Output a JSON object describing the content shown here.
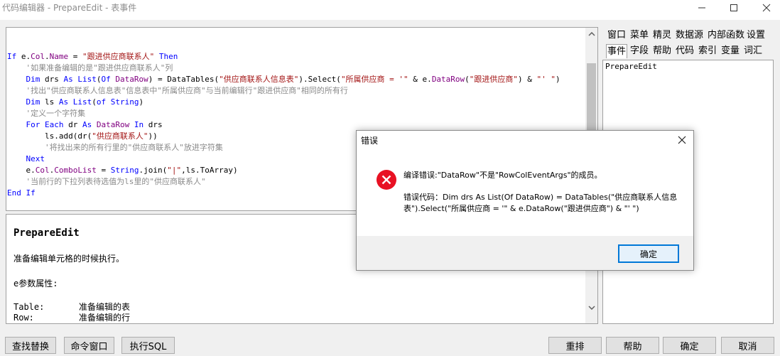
{
  "window": {
    "title": "代码编辑器 - PrepareEdit - 表事件"
  },
  "editor": {
    "lines": [
      [
        {
          "c": "kw",
          "t": "If "
        },
        {
          "c": "plain",
          "t": "e."
        },
        {
          "c": "id",
          "t": "Col"
        },
        {
          "c": "plain",
          "t": "."
        },
        {
          "c": "id",
          "t": "Name"
        },
        {
          "c": "plain",
          "t": " = "
        },
        {
          "c": "st",
          "t": "\"跟进供应商联系人\""
        },
        {
          "c": "kw",
          "t": " Then"
        }
      ],
      [
        {
          "c": "plain",
          "t": "    "
        },
        {
          "c": "cm",
          "t": "'如果准备编辑的是\"跟进供应商联系人\"列"
        }
      ],
      [
        {
          "c": "plain",
          "t": "    "
        },
        {
          "c": "kw",
          "t": "Dim"
        },
        {
          "c": "plain",
          "t": " drs "
        },
        {
          "c": "kw",
          "t": "As"
        },
        {
          "c": "plain",
          "t": " "
        },
        {
          "c": "kw",
          "t": "List"
        },
        {
          "c": "plain",
          "t": "("
        },
        {
          "c": "kw",
          "t": "Of"
        },
        {
          "c": "plain",
          "t": " "
        },
        {
          "c": "id",
          "t": "DataRow"
        },
        {
          "c": "plain",
          "t": ") = DataTables("
        },
        {
          "c": "st",
          "t": "\"供应商联系人信息表\""
        },
        {
          "c": "plain",
          "t": ").Select("
        },
        {
          "c": "st",
          "t": "\"所属供应商 = '\""
        },
        {
          "c": "plain",
          "t": " & e."
        },
        {
          "c": "id",
          "t": "DataRow"
        },
        {
          "c": "plain",
          "t": "("
        },
        {
          "c": "st",
          "t": "\"跟进供应商\""
        },
        {
          "c": "plain",
          "t": ") & "
        },
        {
          "c": "st",
          "t": "\"' \""
        },
        {
          "c": "plain",
          "t": ")"
        }
      ],
      [
        {
          "c": "plain",
          "t": "    "
        },
        {
          "c": "cm",
          "t": "'找出\"供应商联系人信息表\"信息表中\"所属供应商\"与当前编辑行\"跟进供应商\"相同的所有行"
        }
      ],
      [
        {
          "c": "plain",
          "t": "    "
        },
        {
          "c": "kw",
          "t": "Dim"
        },
        {
          "c": "plain",
          "t": " ls "
        },
        {
          "c": "kw",
          "t": "As"
        },
        {
          "c": "plain",
          "t": " "
        },
        {
          "c": "kw",
          "t": "List"
        },
        {
          "c": "plain",
          "t": "("
        },
        {
          "c": "kw",
          "t": "of"
        },
        {
          "c": "plain",
          "t": " "
        },
        {
          "c": "kw",
          "t": "String"
        },
        {
          "c": "plain",
          "t": ")"
        }
      ],
      [
        {
          "c": "plain",
          "t": "    "
        },
        {
          "c": "cm",
          "t": "'定义一个字符集"
        }
      ],
      [
        {
          "c": "plain",
          "t": "    "
        },
        {
          "c": "kw",
          "t": "For Each"
        },
        {
          "c": "plain",
          "t": " dr "
        },
        {
          "c": "kw",
          "t": "As"
        },
        {
          "c": "plain",
          "t": " "
        },
        {
          "c": "id",
          "t": "DataRow"
        },
        {
          "c": "plain",
          "t": " "
        },
        {
          "c": "kw",
          "t": "In"
        },
        {
          "c": "plain",
          "t": " drs"
        }
      ],
      [
        {
          "c": "plain",
          "t": "        ls.add(dr("
        },
        {
          "c": "st",
          "t": "\"供应商联系人\""
        },
        {
          "c": "plain",
          "t": "))"
        }
      ],
      [
        {
          "c": "plain",
          "t": "        "
        },
        {
          "c": "cm",
          "t": "'将找出来的所有行里的\"供应商联系人\"放进字符集"
        }
      ],
      [
        {
          "c": "plain",
          "t": "    "
        },
        {
          "c": "kw",
          "t": "Next"
        }
      ],
      [
        {
          "c": "plain",
          "t": "    e."
        },
        {
          "c": "id",
          "t": "Col"
        },
        {
          "c": "plain",
          "t": "."
        },
        {
          "c": "id",
          "t": "ComboList"
        },
        {
          "c": "plain",
          "t": " = "
        },
        {
          "c": "kw",
          "t": "String"
        },
        {
          "c": "plain",
          "t": ".join("
        },
        {
          "c": "st",
          "t": "\"|\""
        },
        {
          "c": "plain",
          "t": ",ls.ToArray)"
        }
      ],
      [
        {
          "c": "plain",
          "t": "    "
        },
        {
          "c": "cm",
          "t": "'当前行的下拉列表待选值为ls里的\"供应商联系人\""
        }
      ],
      [
        {
          "c": "kw",
          "t": "End If"
        }
      ]
    ]
  },
  "help": {
    "title": "PrepareEdit",
    "description": "准备编辑单元格的时候执行。",
    "props_heading": "e参数属性:",
    "rows": [
      {
        "key": "Table:",
        "value": "准备编辑的表"
      },
      {
        "key": "Row:",
        "value": "准备编辑的行"
      }
    ]
  },
  "side_panel": {
    "tabs_row1": [
      "窗口",
      "菜单",
      "精灵",
      "数据源",
      "内部函数",
      "设置"
    ],
    "tabs_row2": [
      "事件",
      "字段",
      "帮助",
      "代码",
      "索引",
      "变量",
      "词汇"
    ],
    "active_tab": "事件",
    "list_items": [
      "PrepareEdit"
    ]
  },
  "buttons": {
    "find_replace": "查找替换",
    "command_window": "命令窗口",
    "exec_sql": "执行SQL",
    "rearrange": "重排",
    "help": "帮助",
    "ok": "确定",
    "cancel": "取消"
  },
  "dialog": {
    "title": "错误",
    "message": "编译错误:\"DataRow\"不是\"RowColEventArgs\"的成员。",
    "detail": "错误代码：Dim drs As List(Of DataRow) = DataTables(\"供应商联系人信息表\").Select(\"所属供应商 = '\" & e.DataRow(\"跟进供应商\") & \"' \")",
    "ok_label": "确定",
    "icon": "error-icon",
    "icon_color": "#e81123"
  },
  "colors": {
    "keyword": "#0000ff",
    "comment": "#8a8a8a",
    "string": "#a31515",
    "identifier": "#800080",
    "dialog_ok_border": "#0078d7"
  }
}
